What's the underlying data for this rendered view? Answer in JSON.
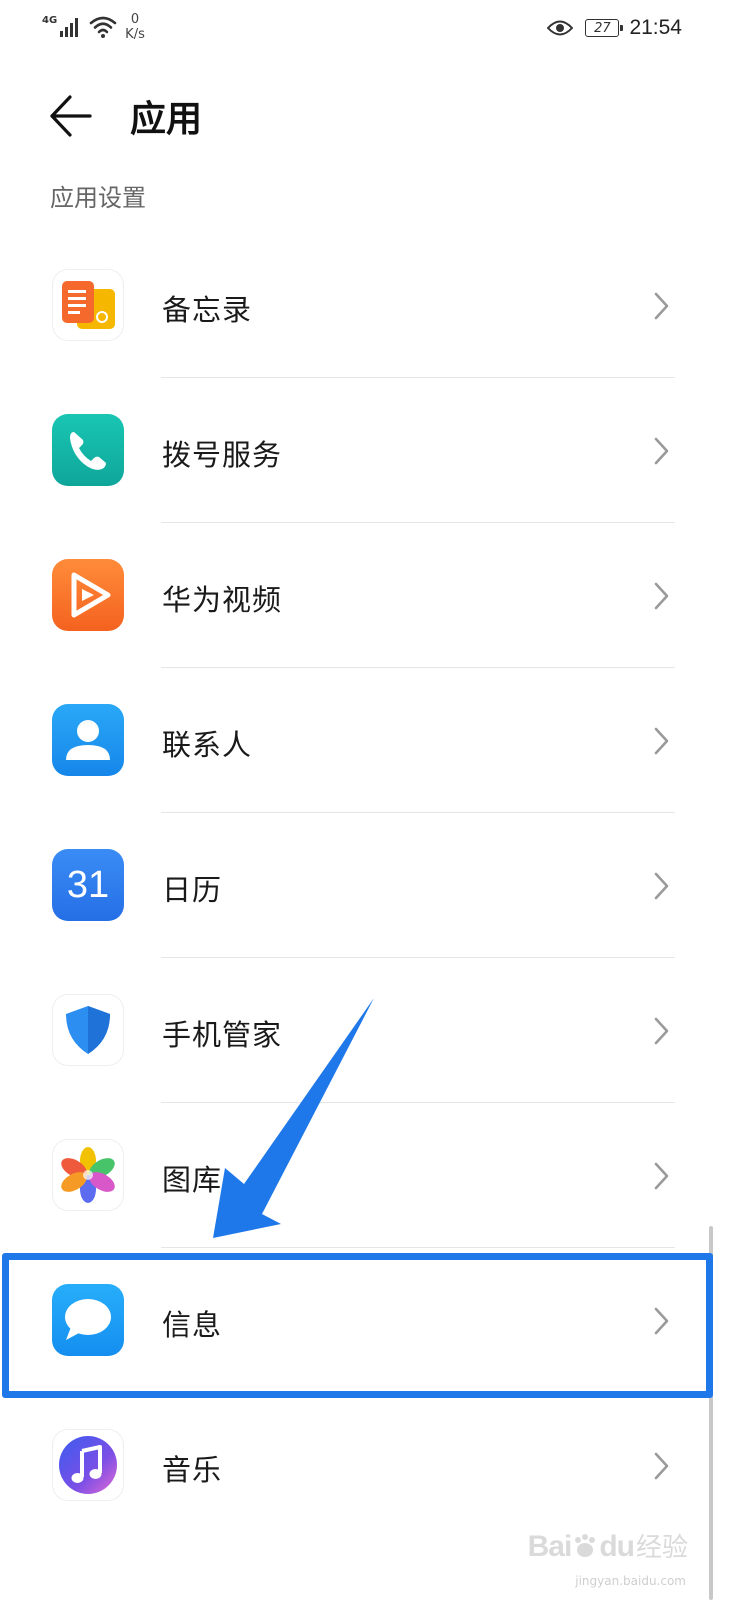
{
  "status_bar": {
    "network": "4G",
    "speed_value": "0",
    "speed_unit": "K/s",
    "battery": "27",
    "time": "21:54"
  },
  "header": {
    "title": "应用"
  },
  "section": {
    "title": "应用设置"
  },
  "apps": [
    {
      "label": "备忘录",
      "icon": "notes-icon"
    },
    {
      "label": "拨号服务",
      "icon": "phone-icon"
    },
    {
      "label": "华为视频",
      "icon": "video-play-icon"
    },
    {
      "label": "联系人",
      "icon": "contact-person-icon"
    },
    {
      "label": "日历",
      "icon": "calendar-icon",
      "icon_text": "31"
    },
    {
      "label": "手机管家",
      "icon": "shield-icon"
    },
    {
      "label": "图库",
      "icon": "gallery-flower-icon"
    },
    {
      "label": "信息",
      "icon": "message-bubble-icon"
    },
    {
      "label": "音乐",
      "icon": "music-note-icon"
    }
  ],
  "watermark": {
    "brand": "Bai",
    "brand_suffix": "du",
    "brand_cn": "经验",
    "url": "jingyan.baidu.com"
  },
  "colors": {
    "annotation": "#1e78ea",
    "divider": "#e6e6e6",
    "secondary_text": "#666666"
  }
}
